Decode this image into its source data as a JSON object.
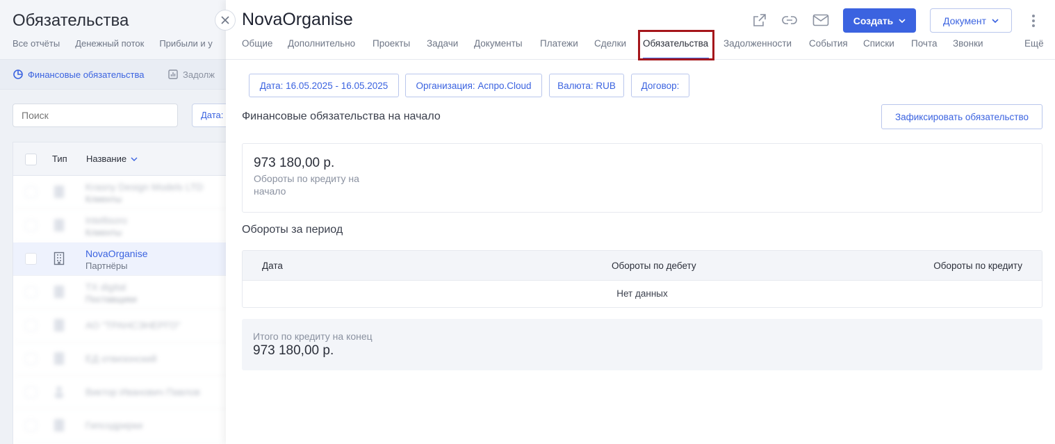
{
  "background": {
    "title": "Обязательства",
    "tabs": [
      "Все отчёты",
      "Денежный поток",
      "Прибыли и у"
    ],
    "subnav": {
      "active": "Финансовые обязательства",
      "other": "Задолж"
    },
    "search_placeholder": "Поиск",
    "date_button": "Дата:",
    "table": {
      "col_type": "Тип",
      "col_name": "Название",
      "selected_row": {
        "name": "NovaOrganise",
        "sub": "Партнёры"
      },
      "blurred_rows": [
        {
          "name": "Krasny Design Models LTD",
          "sub": "Клиенты"
        },
        {
          "name": "Intellisoro",
          "sub": "Клиенты"
        },
        {
          "name": "TX digital",
          "sub": "Поставщики"
        },
        {
          "name": "АО \"ТРАНСЭНЕРГО\"",
          "sub": ""
        },
        {
          "name": "ЕД отвизонский",
          "sub": ""
        },
        {
          "name": "Виктор Иванович Павлов",
          "sub": ""
        },
        {
          "name": "Гипсодрирки",
          "sub": ""
        }
      ]
    }
  },
  "panel": {
    "title": "NovaOrganise",
    "create_label": "Создать",
    "document_label": "Документ",
    "tabs": [
      "Общие",
      "Дополнительно",
      "Проекты",
      "Задачи",
      "Документы",
      "Платежи",
      "Сделки",
      "Обязательства",
      "Задолженности",
      "События",
      "Списки",
      "Почта",
      "Звонки",
      "Ещё"
    ],
    "active_tab": "Обязательства",
    "filters": {
      "date": "Дата: 16.05.2025 - 16.05.2025",
      "org": "Организация: Аспро.Cloud",
      "currency": "Валюта: RUB",
      "contract": "Договор:"
    },
    "opening_title": "Финансовые обязательства на начало",
    "fix_button": "Зафиксировать обязательство",
    "opening_amount": "973 180,00 р.",
    "opening_desc": "Обороты по кредиту на начало",
    "period_title": "Обороты за период",
    "table": {
      "col_date": "Дата",
      "col_debit": "Обороты по дебету",
      "col_credit": "Обороты по кредиту",
      "empty": "Нет данных"
    },
    "total_label": "Итого по кредиту на конец",
    "total_amount": "973 180,00 р."
  },
  "colors": {
    "accent": "#3b63e0",
    "highlight": "#a5161b"
  }
}
